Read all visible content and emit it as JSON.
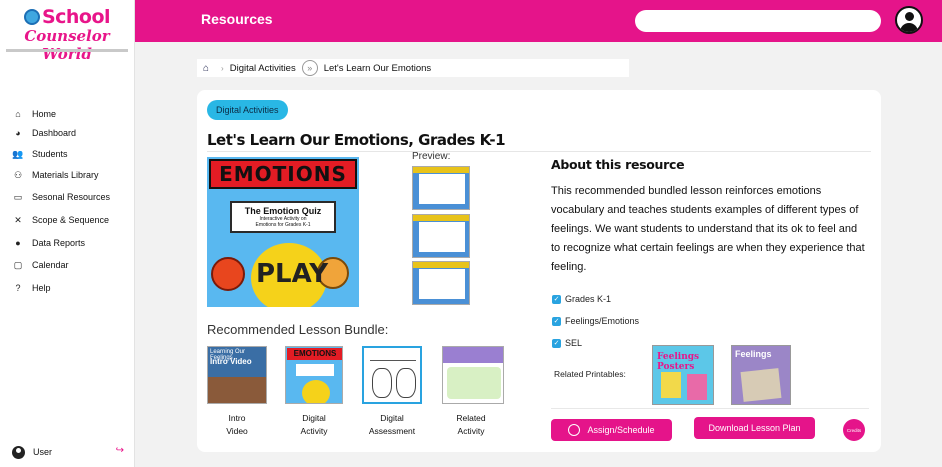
{
  "brand": {
    "line1": "School",
    "line2": "Counselor World",
    "accent": "#e5148a"
  },
  "header": {
    "title": "Resources",
    "search_placeholder": ""
  },
  "sidebar": {
    "items": [
      {
        "label": "Home",
        "icon": "home-icon",
        "glyph": "⌂"
      },
      {
        "label": "Dashboard",
        "icon": "pie-chart-icon",
        "glyph": "◕"
      },
      {
        "label": "Students",
        "icon": "students-icon",
        "glyph": "👥"
      },
      {
        "label": "Materials Library",
        "icon": "library-icon",
        "glyph": "⚇"
      },
      {
        "label": "Sesonal Resources",
        "icon": "seasonal-icon",
        "glyph": "▭"
      },
      {
        "label": "Scope & Sequence",
        "icon": "scope-icon",
        "glyph": "✕"
      },
      {
        "label": "Data Reports",
        "icon": "data-reports-icon",
        "glyph": "●"
      },
      {
        "label": "Calendar",
        "icon": "calendar-icon",
        "glyph": "▢"
      },
      {
        "label": "Help",
        "icon": "help-icon",
        "glyph": "?"
      }
    ],
    "user_label": "User"
  },
  "breadcrumb": {
    "item1": "Digital Activities",
    "item2": "Let's Learn Our Emotions"
  },
  "resource": {
    "tag": "Digital Activities",
    "title": "Let's Learn Our Emotions, Grades K-1",
    "cover": {
      "banner": "EMOTIONS",
      "quiz_title": "The Emotion Quiz",
      "quiz_sub1": "Interactive Activity on",
      "quiz_sub2": "Emotions for Grades K-1",
      "play": "PLAY"
    },
    "preview_label": "Preview:",
    "about_heading": "About this resource",
    "about_text": "This recommended bundled lesson reinforces emotions vocabulary and teaches students examples of different types of feelings. We want students to understand that its ok to feel and to recognize what certain feelings are when they experience that feeling.",
    "tags": [
      "Grades K-1",
      "Feelings/Emotions",
      "SEL"
    ],
    "related_label": "Related Printables:",
    "related": [
      {
        "title": "Feelings Posters"
      },
      {
        "title": "Feelings"
      }
    ],
    "bundle_label": "Recommended Lesson Bundle:",
    "bundle": [
      {
        "line1": "Intro",
        "line2": "Video",
        "thumb_text1": "Learning Our Feelings",
        "thumb_text2": "Intro Video"
      },
      {
        "line1": "Digital",
        "line2": "Activity",
        "thumb_text1": "EMOTIONS"
      },
      {
        "line1": "Digital",
        "line2": "Assessment"
      },
      {
        "line1": "Related",
        "line2": "Activity"
      }
    ],
    "actions": {
      "assign": "Assign/Schedule",
      "download": "Download Lesson Plan",
      "credits": "Credits"
    }
  }
}
